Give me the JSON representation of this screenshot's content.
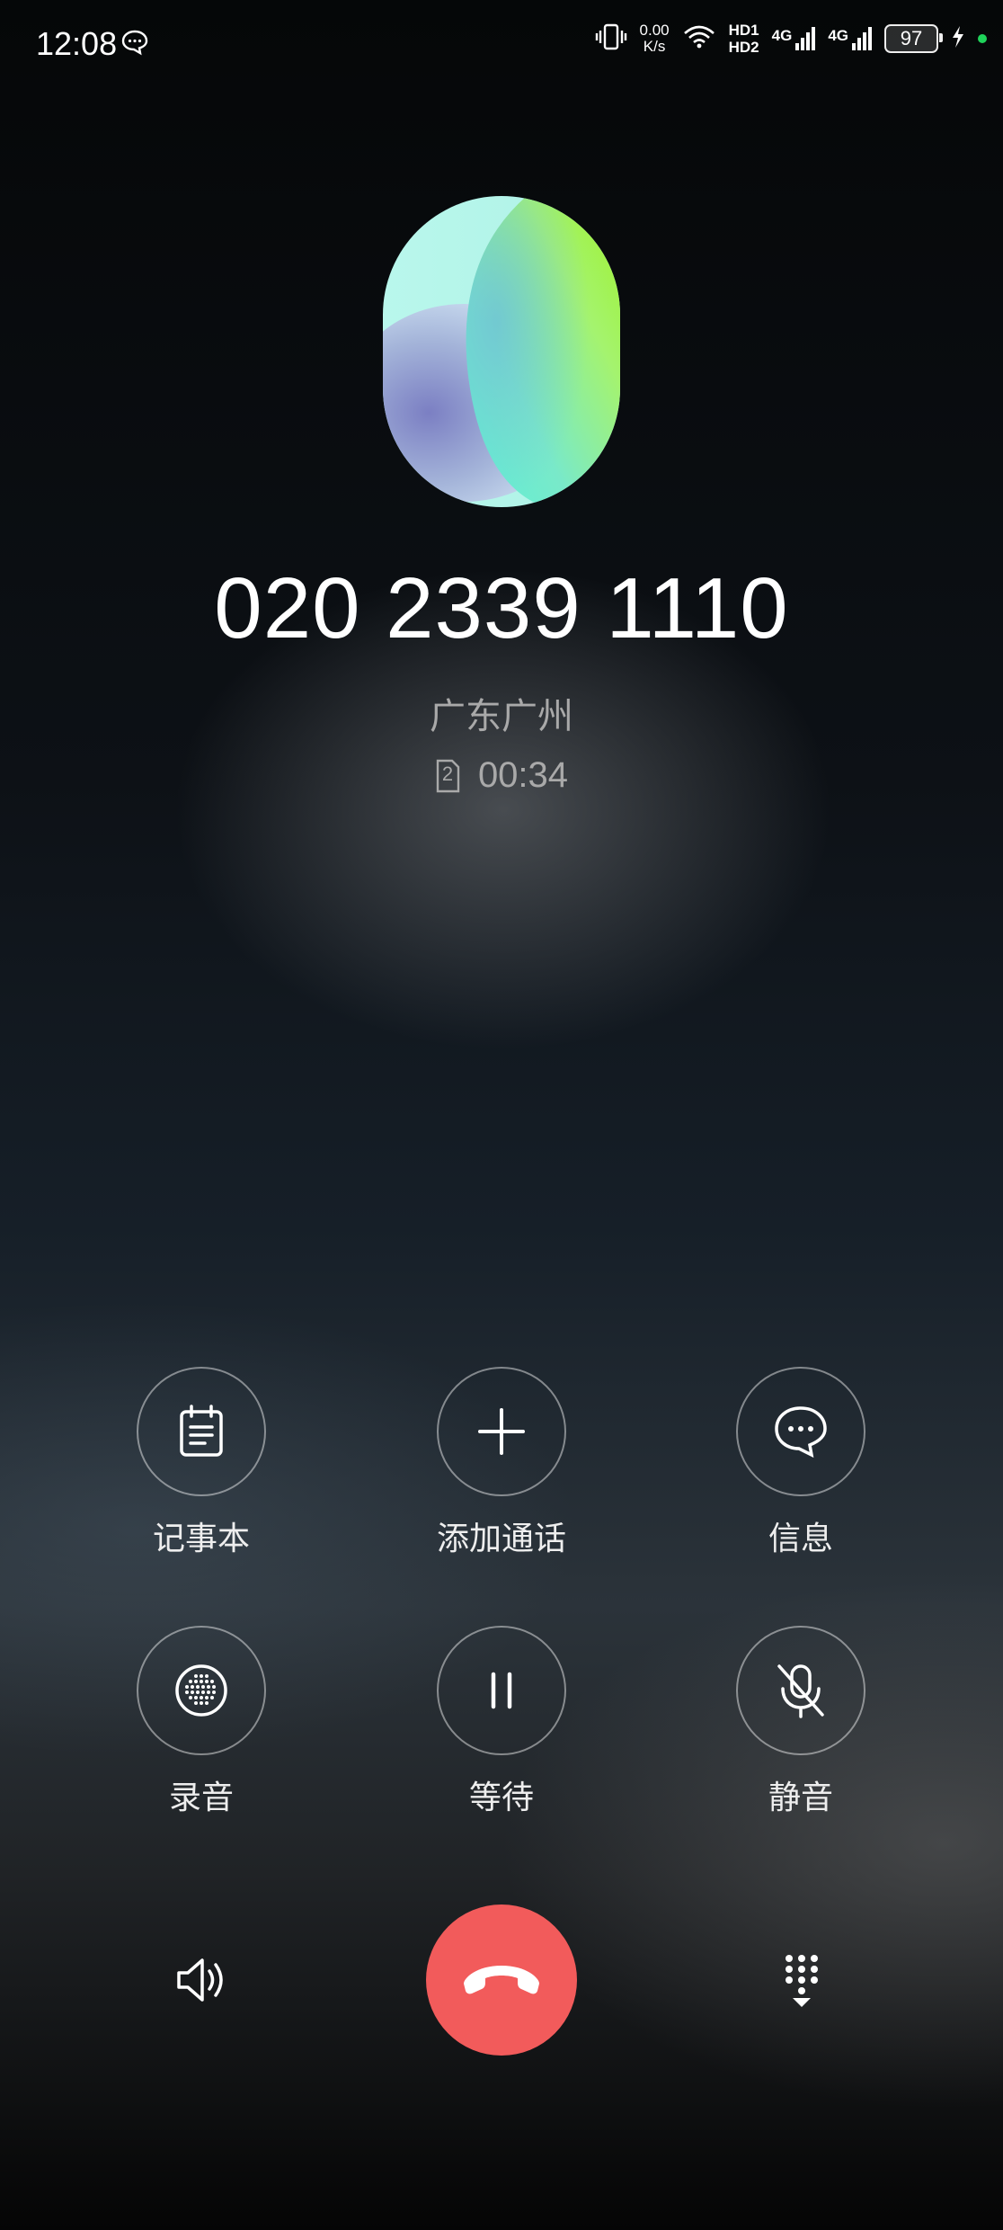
{
  "status_bar": {
    "time": "12:08",
    "net_speed_value": "0.00",
    "net_speed_unit": "K/s",
    "hd1": "HD1",
    "hd2": "HD2",
    "sim1_label": "4G",
    "sim2_label": "4G",
    "battery": "97",
    "icons": [
      "chat-bubble-icon",
      "vibrate-icon",
      "wifi-icon",
      "signal-icon",
      "signal-icon",
      "battery-icon",
      "charging-icon"
    ],
    "dot_color": "#1fd35a"
  },
  "call": {
    "number": "020 2339 1110",
    "location": "广东广州",
    "sim_slot": "2",
    "duration": "00:34"
  },
  "controls": [
    {
      "label": "记事本",
      "icon": "notepad-icon"
    },
    {
      "label": "添加通话",
      "icon": "add-call-icon"
    },
    {
      "label": "信息",
      "icon": "message-icon"
    },
    {
      "label": "录音",
      "icon": "record-icon"
    },
    {
      "label": "等待",
      "icon": "hold-icon"
    },
    {
      "label": "静音",
      "icon": "mute-icon"
    }
  ],
  "bottom_bar": {
    "speaker_icon": "speaker-icon",
    "end_call_icon": "end-call-icon",
    "end_call_color": "#f25b5b",
    "dialpad_icon": "dialpad-icon"
  }
}
